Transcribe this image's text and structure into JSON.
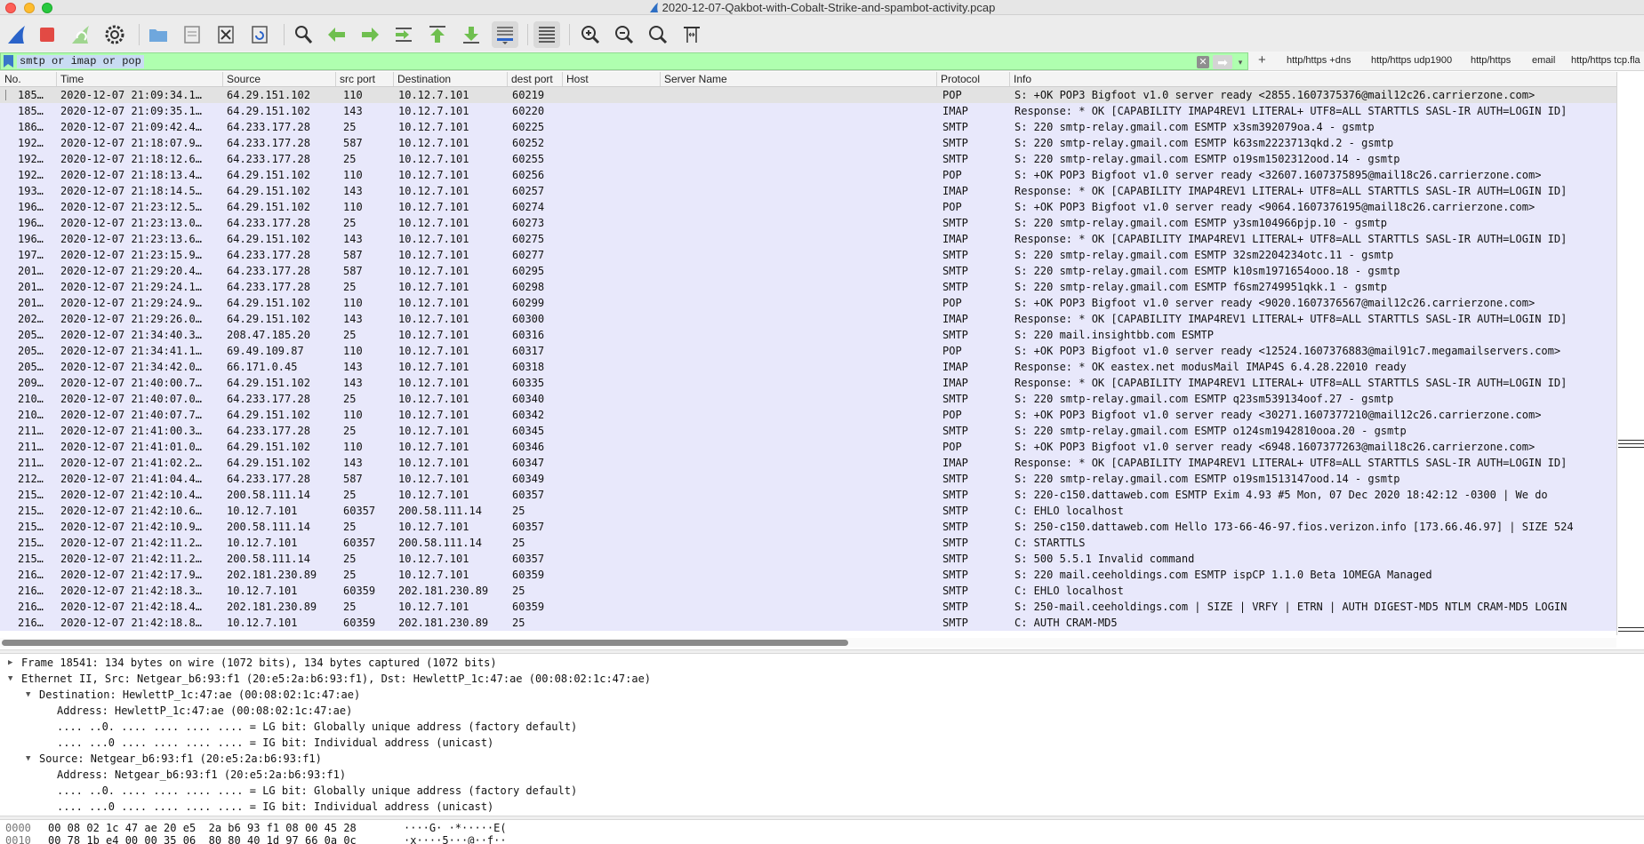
{
  "window": {
    "title": "2020-12-07-Qakbot-with-Cobalt-Strike-and-spambot-activity.pcap"
  },
  "toolbar": {
    "icons": [
      "shark-fin-start-icon",
      "stop-capture-icon",
      "restart-capture-icon",
      "capture-options-icon",
      "open-file-icon",
      "save-file-icon",
      "close-file-icon",
      "reload-file-icon",
      "find-packet-icon",
      "go-back-icon",
      "go-forward-icon",
      "go-to-packet-icon",
      "first-packet-icon",
      "last-packet-icon",
      "auto-scroll-icon",
      "colorize-icon",
      "zoom-in-icon",
      "zoom-out-icon",
      "normal-size-icon",
      "resize-columns-icon"
    ]
  },
  "filter": {
    "value": "smtp or imap or pop",
    "clear_label": "✕",
    "apply_label": "➡",
    "dropdown_label": "▾",
    "add_label": "+",
    "buttons": [
      "http/https +dns",
      "http/https udp1900",
      "http/https",
      "email",
      "http/https tcp.fla"
    ]
  },
  "columns": {
    "no": "No.",
    "time": "Time",
    "source": "Source",
    "src_port": "src port",
    "destination": "Destination",
    "dest_port": "dest port",
    "host": "Host",
    "server_name": "Server Name",
    "protocol": "Protocol",
    "info": "Info"
  },
  "packets": [
    {
      "no": "185…",
      "time": "2020-12-07 21:09:34.1…",
      "src": "64.29.151.102",
      "sport": "110",
      "dst": "10.12.7.101",
      "dport": "60219",
      "proto": "POP",
      "info": "S: +OK POP3 Bigfoot v1.0 server ready <2855.1607375376@mail12c26.carrierzone.com>"
    },
    {
      "no": "185…",
      "time": "2020-12-07 21:09:35.1…",
      "src": "64.29.151.102",
      "sport": "143",
      "dst": "10.12.7.101",
      "dport": "60220",
      "proto": "IMAP",
      "info": "Response: * OK [CAPABILITY IMAP4REV1 LITERAL+ UTF8=ALL STARTTLS SASL-IR AUTH=LOGIN ID]"
    },
    {
      "no": "186…",
      "time": "2020-12-07 21:09:42.4…",
      "src": "64.233.177.28",
      "sport": "25",
      "dst": "10.12.7.101",
      "dport": "60225",
      "proto": "SMTP",
      "info": "S: 220 smtp-relay.gmail.com ESMTP x3sm392079oa.4 - gsmtp"
    },
    {
      "no": "192…",
      "time": "2020-12-07 21:18:07.9…",
      "src": "64.233.177.28",
      "sport": "587",
      "dst": "10.12.7.101",
      "dport": "60252",
      "proto": "SMTP",
      "info": "S: 220 smtp-relay.gmail.com ESMTP k63sm2223713qkd.2 - gsmtp"
    },
    {
      "no": "192…",
      "time": "2020-12-07 21:18:12.6…",
      "src": "64.233.177.28",
      "sport": "25",
      "dst": "10.12.7.101",
      "dport": "60255",
      "proto": "SMTP",
      "info": "S: 220 smtp-relay.gmail.com ESMTP o19sm1502312ood.14 - gsmtp"
    },
    {
      "no": "192…",
      "time": "2020-12-07 21:18:13.4…",
      "src": "64.29.151.102",
      "sport": "110",
      "dst": "10.12.7.101",
      "dport": "60256",
      "proto": "POP",
      "info": "S: +OK POP3 Bigfoot v1.0 server ready <32607.1607375895@mail18c26.carrierzone.com>"
    },
    {
      "no": "193…",
      "time": "2020-12-07 21:18:14.5…",
      "src": "64.29.151.102",
      "sport": "143",
      "dst": "10.12.7.101",
      "dport": "60257",
      "proto": "IMAP",
      "info": "Response: * OK [CAPABILITY IMAP4REV1 LITERAL+ UTF8=ALL STARTTLS SASL-IR AUTH=LOGIN ID]"
    },
    {
      "no": "196…",
      "time": "2020-12-07 21:23:12.5…",
      "src": "64.29.151.102",
      "sport": "110",
      "dst": "10.12.7.101",
      "dport": "60274",
      "proto": "POP",
      "info": "S: +OK POP3 Bigfoot v1.0 server ready <9064.1607376195@mail18c26.carrierzone.com>"
    },
    {
      "no": "196…",
      "time": "2020-12-07 21:23:13.0…",
      "src": "64.233.177.28",
      "sport": "25",
      "dst": "10.12.7.101",
      "dport": "60273",
      "proto": "SMTP",
      "info": "S: 220 smtp-relay.gmail.com ESMTP y3sm104966pjp.10 - gsmtp"
    },
    {
      "no": "196…",
      "time": "2020-12-07 21:23:13.6…",
      "src": "64.29.151.102",
      "sport": "143",
      "dst": "10.12.7.101",
      "dport": "60275",
      "proto": "IMAP",
      "info": "Response: * OK [CAPABILITY IMAP4REV1 LITERAL+ UTF8=ALL STARTTLS SASL-IR AUTH=LOGIN ID]"
    },
    {
      "no": "197…",
      "time": "2020-12-07 21:23:15.9…",
      "src": "64.233.177.28",
      "sport": "587",
      "dst": "10.12.7.101",
      "dport": "60277",
      "proto": "SMTP",
      "info": "S: 220 smtp-relay.gmail.com ESMTP 32sm2204234otc.11 - gsmtp"
    },
    {
      "no": "201…",
      "time": "2020-12-07 21:29:20.4…",
      "src": "64.233.177.28",
      "sport": "587",
      "dst": "10.12.7.101",
      "dport": "60295",
      "proto": "SMTP",
      "info": "S: 220 smtp-relay.gmail.com ESMTP k10sm1971654ooo.18 - gsmtp"
    },
    {
      "no": "201…",
      "time": "2020-12-07 21:29:24.1…",
      "src": "64.233.177.28",
      "sport": "25",
      "dst": "10.12.7.101",
      "dport": "60298",
      "proto": "SMTP",
      "info": "S: 220 smtp-relay.gmail.com ESMTP f6sm2749951qkk.1 - gsmtp"
    },
    {
      "no": "201…",
      "time": "2020-12-07 21:29:24.9…",
      "src": "64.29.151.102",
      "sport": "110",
      "dst": "10.12.7.101",
      "dport": "60299",
      "proto": "POP",
      "info": "S: +OK POP3 Bigfoot v1.0 server ready <9020.1607376567@mail12c26.carrierzone.com>"
    },
    {
      "no": "202…",
      "time": "2020-12-07 21:29:26.0…",
      "src": "64.29.151.102",
      "sport": "143",
      "dst": "10.12.7.101",
      "dport": "60300",
      "proto": "IMAP",
      "info": "Response: * OK [CAPABILITY IMAP4REV1 LITERAL+ UTF8=ALL STARTTLS SASL-IR AUTH=LOGIN ID]"
    },
    {
      "no": "205…",
      "time": "2020-12-07 21:34:40.3…",
      "src": "208.47.185.20",
      "sport": "25",
      "dst": "10.12.7.101",
      "dport": "60316",
      "proto": "SMTP",
      "info": "S: 220 mail.insightbb.com ESMTP"
    },
    {
      "no": "205…",
      "time": "2020-12-07 21:34:41.1…",
      "src": "69.49.109.87",
      "sport": "110",
      "dst": "10.12.7.101",
      "dport": "60317",
      "proto": "POP",
      "info": "S: +OK POP3 Bigfoot v1.0 server ready <12524.1607376883@mail91c7.megamailservers.com>"
    },
    {
      "no": "205…",
      "time": "2020-12-07 21:34:42.0…",
      "src": "66.171.0.45",
      "sport": "143",
      "dst": "10.12.7.101",
      "dport": "60318",
      "proto": "IMAP",
      "info": "Response: * OK eastex.net modusMail IMAP4S 6.4.28.22010 ready"
    },
    {
      "no": "209…",
      "time": "2020-12-07 21:40:00.7…",
      "src": "64.29.151.102",
      "sport": "143",
      "dst": "10.12.7.101",
      "dport": "60335",
      "proto": "IMAP",
      "info": "Response: * OK [CAPABILITY IMAP4REV1 LITERAL+ UTF8=ALL STARTTLS SASL-IR AUTH=LOGIN ID]"
    },
    {
      "no": "210…",
      "time": "2020-12-07 21:40:07.0…",
      "src": "64.233.177.28",
      "sport": "25",
      "dst": "10.12.7.101",
      "dport": "60340",
      "proto": "SMTP",
      "info": "S: 220 smtp-relay.gmail.com ESMTP q23sm539134oof.27 - gsmtp"
    },
    {
      "no": "210…",
      "time": "2020-12-07 21:40:07.7…",
      "src": "64.29.151.102",
      "sport": "110",
      "dst": "10.12.7.101",
      "dport": "60342",
      "proto": "POP",
      "info": "S: +OK POP3 Bigfoot v1.0 server ready <30271.1607377210@mail12c26.carrierzone.com>"
    },
    {
      "no": "211…",
      "time": "2020-12-07 21:41:00.3…",
      "src": "64.233.177.28",
      "sport": "25",
      "dst": "10.12.7.101",
      "dport": "60345",
      "proto": "SMTP",
      "info": "S: 220 smtp-relay.gmail.com ESMTP o124sm1942810ooa.20 - gsmtp"
    },
    {
      "no": "211…",
      "time": "2020-12-07 21:41:01.0…",
      "src": "64.29.151.102",
      "sport": "110",
      "dst": "10.12.7.101",
      "dport": "60346",
      "proto": "POP",
      "info": "S: +OK POP3 Bigfoot v1.0 server ready <6948.1607377263@mail18c26.carrierzone.com>"
    },
    {
      "no": "211…",
      "time": "2020-12-07 21:41:02.2…",
      "src": "64.29.151.102",
      "sport": "143",
      "dst": "10.12.7.101",
      "dport": "60347",
      "proto": "IMAP",
      "info": "Response: * OK [CAPABILITY IMAP4REV1 LITERAL+ UTF8=ALL STARTTLS SASL-IR AUTH=LOGIN ID]"
    },
    {
      "no": "212…",
      "time": "2020-12-07 21:41:04.4…",
      "src": "64.233.177.28",
      "sport": "587",
      "dst": "10.12.7.101",
      "dport": "60349",
      "proto": "SMTP",
      "info": "S: 220 smtp-relay.gmail.com ESMTP o19sm1513147ood.14 - gsmtp"
    },
    {
      "no": "215…",
      "time": "2020-12-07 21:42:10.4…",
      "src": "200.58.111.14",
      "sport": "25",
      "dst": "10.12.7.101",
      "dport": "60357",
      "proto": "SMTP",
      "info": "S: 220-c150.dattaweb.com ESMTP Exim 4.93 #5 Mon, 07 Dec 2020 18:42:12 -0300  |   We do"
    },
    {
      "no": "215…",
      "time": "2020-12-07 21:42:10.6…",
      "src": "10.12.7.101",
      "sport": "60357",
      "dst": "200.58.111.14",
      "dport": "25",
      "proto": "SMTP",
      "info": "C: EHLO localhost"
    },
    {
      "no": "215…",
      "time": "2020-12-07 21:42:10.9…",
      "src": "200.58.111.14",
      "sport": "25",
      "dst": "10.12.7.101",
      "dport": "60357",
      "proto": "SMTP",
      "info": "S: 250-c150.dattaweb.com Hello 173-66-46-97.fios.verizon.info [173.66.46.97] | SIZE 524"
    },
    {
      "no": "215…",
      "time": "2020-12-07 21:42:11.2…",
      "src": "10.12.7.101",
      "sport": "60357",
      "dst": "200.58.111.14",
      "dport": "25",
      "proto": "SMTP",
      "info": "C: STARTTLS"
    },
    {
      "no": "215…",
      "time": "2020-12-07 21:42:11.2…",
      "src": "200.58.111.14",
      "sport": "25",
      "dst": "10.12.7.101",
      "dport": "60357",
      "proto": "SMTP",
      "info": "S: 500 5.5.1 Invalid command"
    },
    {
      "no": "216…",
      "time": "2020-12-07 21:42:17.9…",
      "src": "202.181.230.89",
      "sport": "25",
      "dst": "10.12.7.101",
      "dport": "60359",
      "proto": "SMTP",
      "info": "S: 220 mail.ceeholdings.com ESMTP ispCP 1.1.0 Beta 1OMEGA Managed"
    },
    {
      "no": "216…",
      "time": "2020-12-07 21:42:18.3…",
      "src": "10.12.7.101",
      "sport": "60359",
      "dst": "202.181.230.89",
      "dport": "25",
      "proto": "SMTP",
      "info": "C: EHLO localhost"
    },
    {
      "no": "216…",
      "time": "2020-12-07 21:42:18.4…",
      "src": "202.181.230.89",
      "sport": "25",
      "dst": "10.12.7.101",
      "dport": "60359",
      "proto": "SMTP",
      "info": "S: 250-mail.ceeholdings.com | SIZE | VRFY | ETRN | AUTH DIGEST-MD5 NTLM CRAM-MD5 LOGIN"
    },
    {
      "no": "216…",
      "time": "2020-12-07 21:42:18.8…",
      "src": "10.12.7.101",
      "sport": "60359",
      "dst": "202.181.230.89",
      "dport": "25",
      "proto": "SMTP",
      "info": "C: AUTH CRAM-MD5"
    }
  ],
  "details": [
    {
      "text": "Frame 18541: 134 bytes on wire (1072 bits), 134 bytes captured (1072 bits)",
      "level": 0,
      "toggle": "▶"
    },
    {
      "text": "Ethernet II, Src: Netgear_b6:93:f1 (20:e5:2a:b6:93:f1), Dst: HewlettP_1c:47:ae (00:08:02:1c:47:ae)",
      "level": 0,
      "toggle": "▼"
    },
    {
      "text": "Destination: HewlettP_1c:47:ae (00:08:02:1c:47:ae)",
      "level": 1,
      "toggle": "▼"
    },
    {
      "text": "Address: HewlettP_1c:47:ae (00:08:02:1c:47:ae)",
      "level": 2,
      "toggle": ""
    },
    {
      "text": ".... ..0. .... .... .... .... = LG bit: Globally unique address (factory default)",
      "level": 2,
      "toggle": ""
    },
    {
      "text": ".... ...0 .... .... .... .... = IG bit: Individual address (unicast)",
      "level": 2,
      "toggle": ""
    },
    {
      "text": "Source: Netgear_b6:93:f1 (20:e5:2a:b6:93:f1)",
      "level": 1,
      "toggle": "▼"
    },
    {
      "text": "Address: Netgear_b6:93:f1 (20:e5:2a:b6:93:f1)",
      "level": 2,
      "toggle": ""
    },
    {
      "text": ".... ..0. .... .... .... .... = LG bit: Globally unique address (factory default)",
      "level": 2,
      "toggle": ""
    },
    {
      "text": ".... ...0 .... .... .... .... = IG bit: Individual address (unicast)",
      "level": 2,
      "toggle": ""
    }
  ],
  "hex": [
    {
      "offset": "0000",
      "bytes": "00 08 02 1c 47 ae 20 e5  2a b6 93 f1 08 00 45 28",
      "ascii": "····G· ·*·····E("
    },
    {
      "offset": "0010",
      "bytes": "00 78 1b e4 00 00 35 06  80 80 40 1d 97 66 0a 0c",
      "ascii": "·x····5···@··f··"
    }
  ],
  "colors": {
    "row_bg": "#e8e8fb",
    "selected_row_bg": "#e2e2e2",
    "filter_valid_bg": "#afffaf"
  }
}
